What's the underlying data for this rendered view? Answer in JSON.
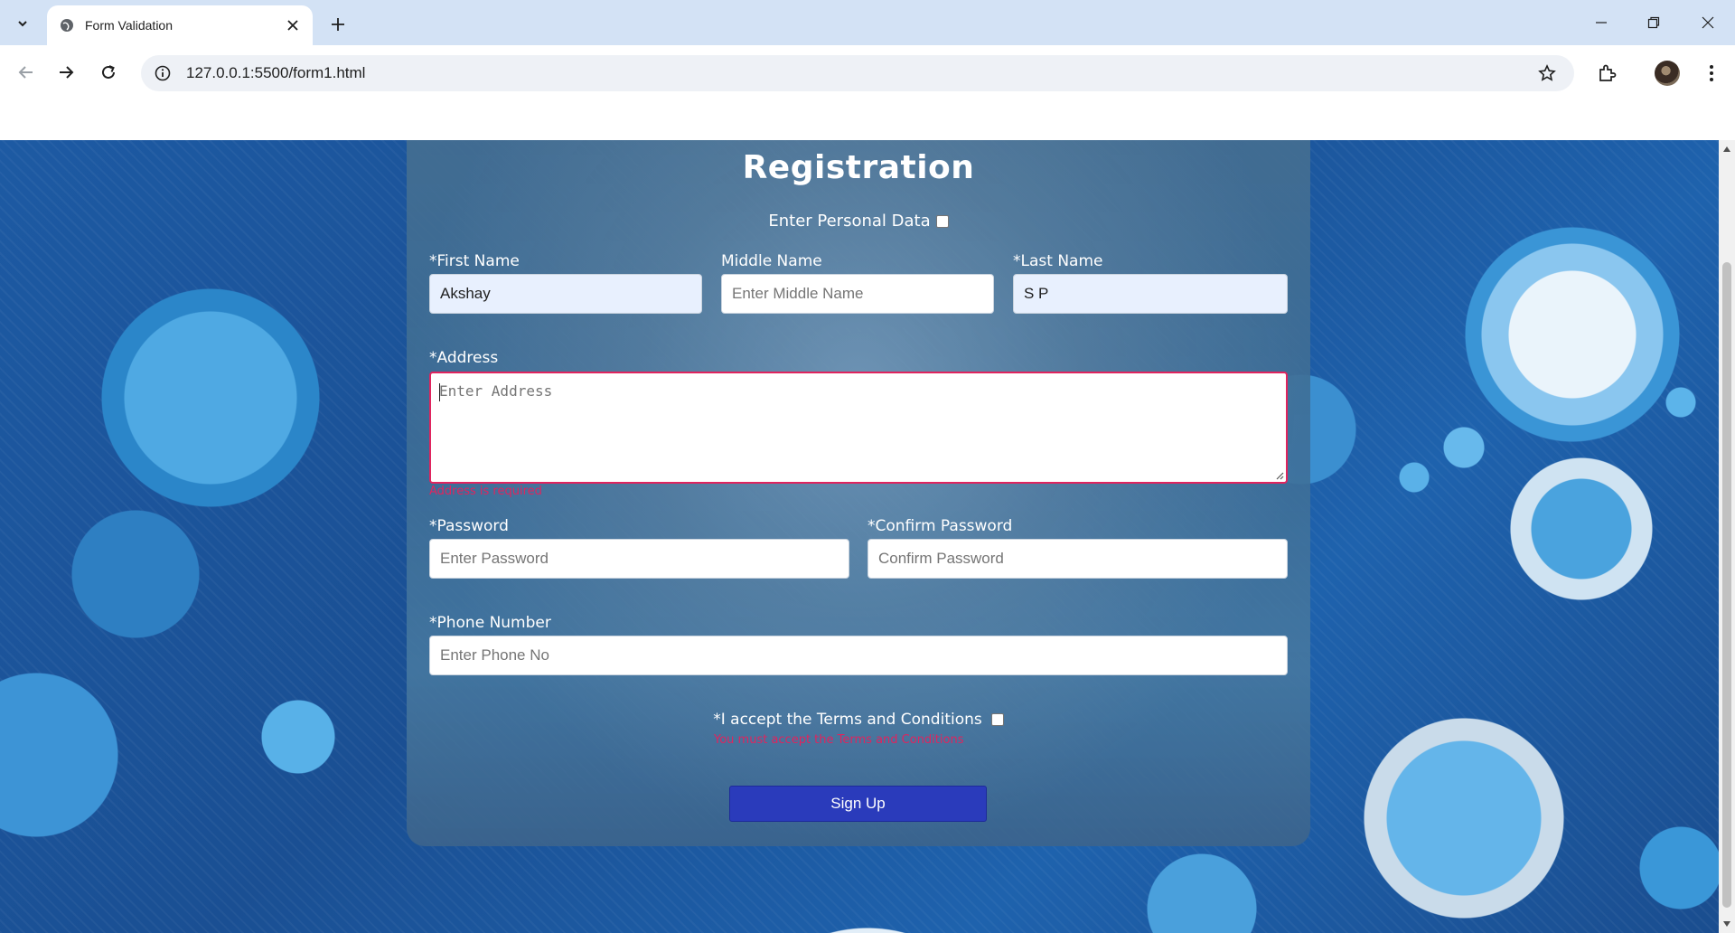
{
  "browser": {
    "tab_title": "Form Validation",
    "url": "127.0.0.1:5500/form1.html"
  },
  "form": {
    "title": "Registration",
    "personal_data_label": "Enter Personal Data",
    "first_name": {
      "label": "*First Name",
      "value": "Akshay"
    },
    "middle_name": {
      "label": "Middle Name",
      "placeholder": "Enter Middle Name"
    },
    "last_name": {
      "label": "*Last Name",
      "value": "S P"
    },
    "address": {
      "label": "*Address",
      "placeholder": "Enter Address",
      "error": "Address is required"
    },
    "password": {
      "label": "*Password",
      "placeholder": "Enter Password"
    },
    "confirm_password": {
      "label": "*Confirm Password",
      "placeholder": "Confirm Password"
    },
    "phone": {
      "label": "*Phone Number",
      "placeholder": "Enter Phone No"
    },
    "terms": {
      "label": "*I accept the Terms and Conditions",
      "error": "You must accept the Terms and Conditions"
    },
    "submit_label": "Sign Up"
  },
  "colors": {
    "error": "#e0245e",
    "button": "#2a3bbb",
    "autofill": "#e8f0fe"
  }
}
